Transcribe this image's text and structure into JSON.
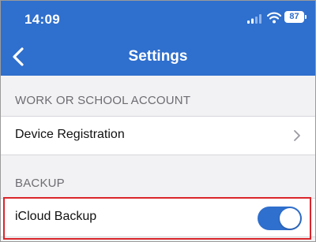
{
  "status_bar": {
    "time": "14:09",
    "battery": "87",
    "icons": [
      "signal-icon",
      "wifi-icon",
      "battery-icon"
    ]
  },
  "nav": {
    "title": "Settings",
    "back_icon": "chevron-left-icon"
  },
  "sections": {
    "account": {
      "header": "WORK OR SCHOOL ACCOUNT",
      "items": [
        {
          "label": "Device Registration",
          "icon": "chevron-right-icon"
        }
      ]
    },
    "backup": {
      "header": "BACKUP",
      "items": [
        {
          "label": "iCloud Backup",
          "toggle_on": true
        }
      ]
    }
  },
  "colors": {
    "accent": "#2f6fcd",
    "highlight": "#d9262b",
    "background": "#f2f2f4"
  }
}
